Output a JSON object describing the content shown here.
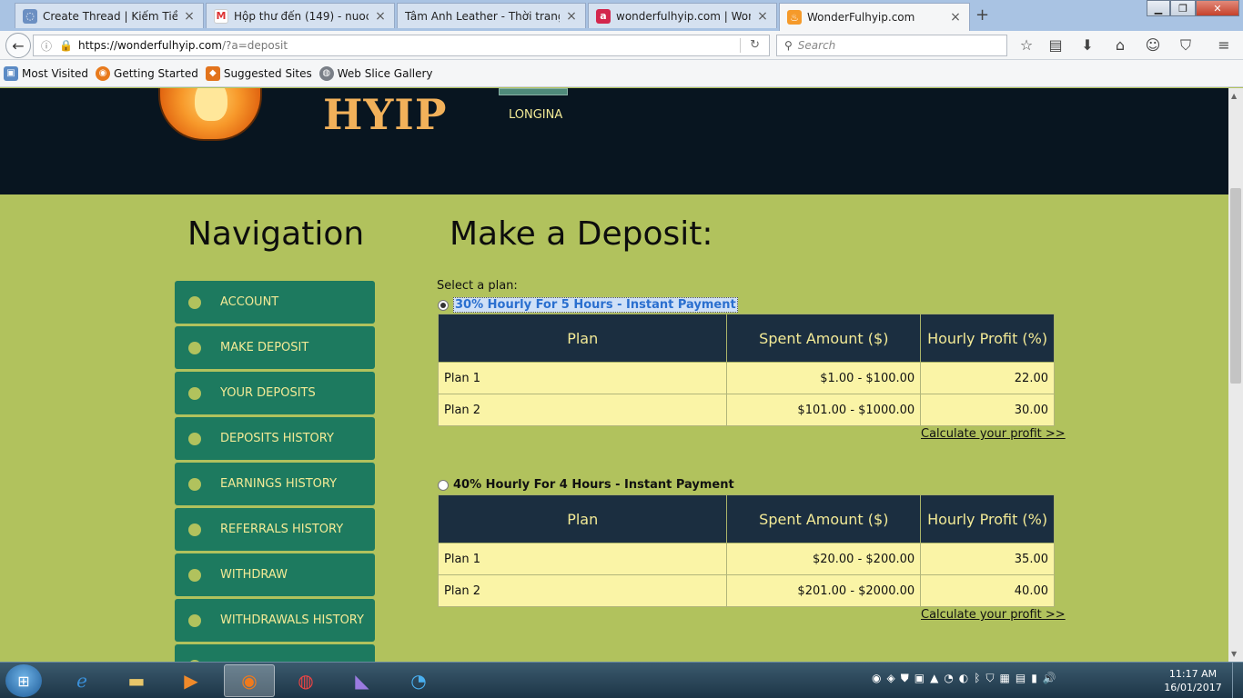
{
  "browser": {
    "tabs": [
      {
        "title": "Create Thread | Kiếm Tiền ...",
        "favicon": "globe-icon"
      },
      {
        "title": "Hộp thư đến (149) - nuoc...",
        "favicon": "gmail-icon"
      },
      {
        "title": "Tâm Anh Leather - Thời trang ...",
        "favicon": "none"
      },
      {
        "title": "wonderfulhyip.com | Won...",
        "favicon": "a-icon"
      },
      {
        "title": "WonderFulhyip.com",
        "favicon": "flame-icon"
      }
    ],
    "url_host": "https://wonderfulhyip.com",
    "url_path": "/?a=deposit",
    "search_placeholder": "Search",
    "bookmarks": [
      "Most Visited",
      "Getting Started",
      "Suggested Sites",
      "Web Slice Gallery"
    ]
  },
  "site": {
    "logo_text": "HYIP",
    "brand_name": "LONGINA"
  },
  "navigation": {
    "heading": "Navigation",
    "items": [
      "ACCOUNT",
      "MAKE DEPOSIT",
      "YOUR DEPOSITS",
      "DEPOSITS HISTORY",
      "EARNINGS HISTORY",
      "REFERRALS HISTORY",
      "WITHDRAW",
      "WITHDRAWALS HISTORY"
    ]
  },
  "deposit": {
    "heading": "Make a Deposit:",
    "select_label": "Select a plan:",
    "columns": [
      "Plan",
      "Spent Amount ($)",
      "Hourly Profit (%)"
    ],
    "calc_link": "Calculate your profit >>",
    "plans": [
      {
        "name": "30% Hourly For 5 Hours - Instant Payment",
        "selected": true,
        "rows": [
          {
            "plan": "Plan 1",
            "amount": "$1.00 - $100.00",
            "profit": "22.00"
          },
          {
            "plan": "Plan 2",
            "amount": "$101.00 - $1000.00",
            "profit": "30.00"
          }
        ]
      },
      {
        "name": "40% Hourly For 4 Hours - Instant Payment",
        "selected": false,
        "rows": [
          {
            "plan": "Plan 1",
            "amount": "$20.00 - $200.00",
            "profit": "35.00"
          },
          {
            "plan": "Plan 2",
            "amount": "$201.00 - $2000.00",
            "profit": "40.00"
          }
        ]
      }
    ]
  },
  "taskbar": {
    "time": "11:17 AM",
    "date": "16/01/2017"
  }
}
